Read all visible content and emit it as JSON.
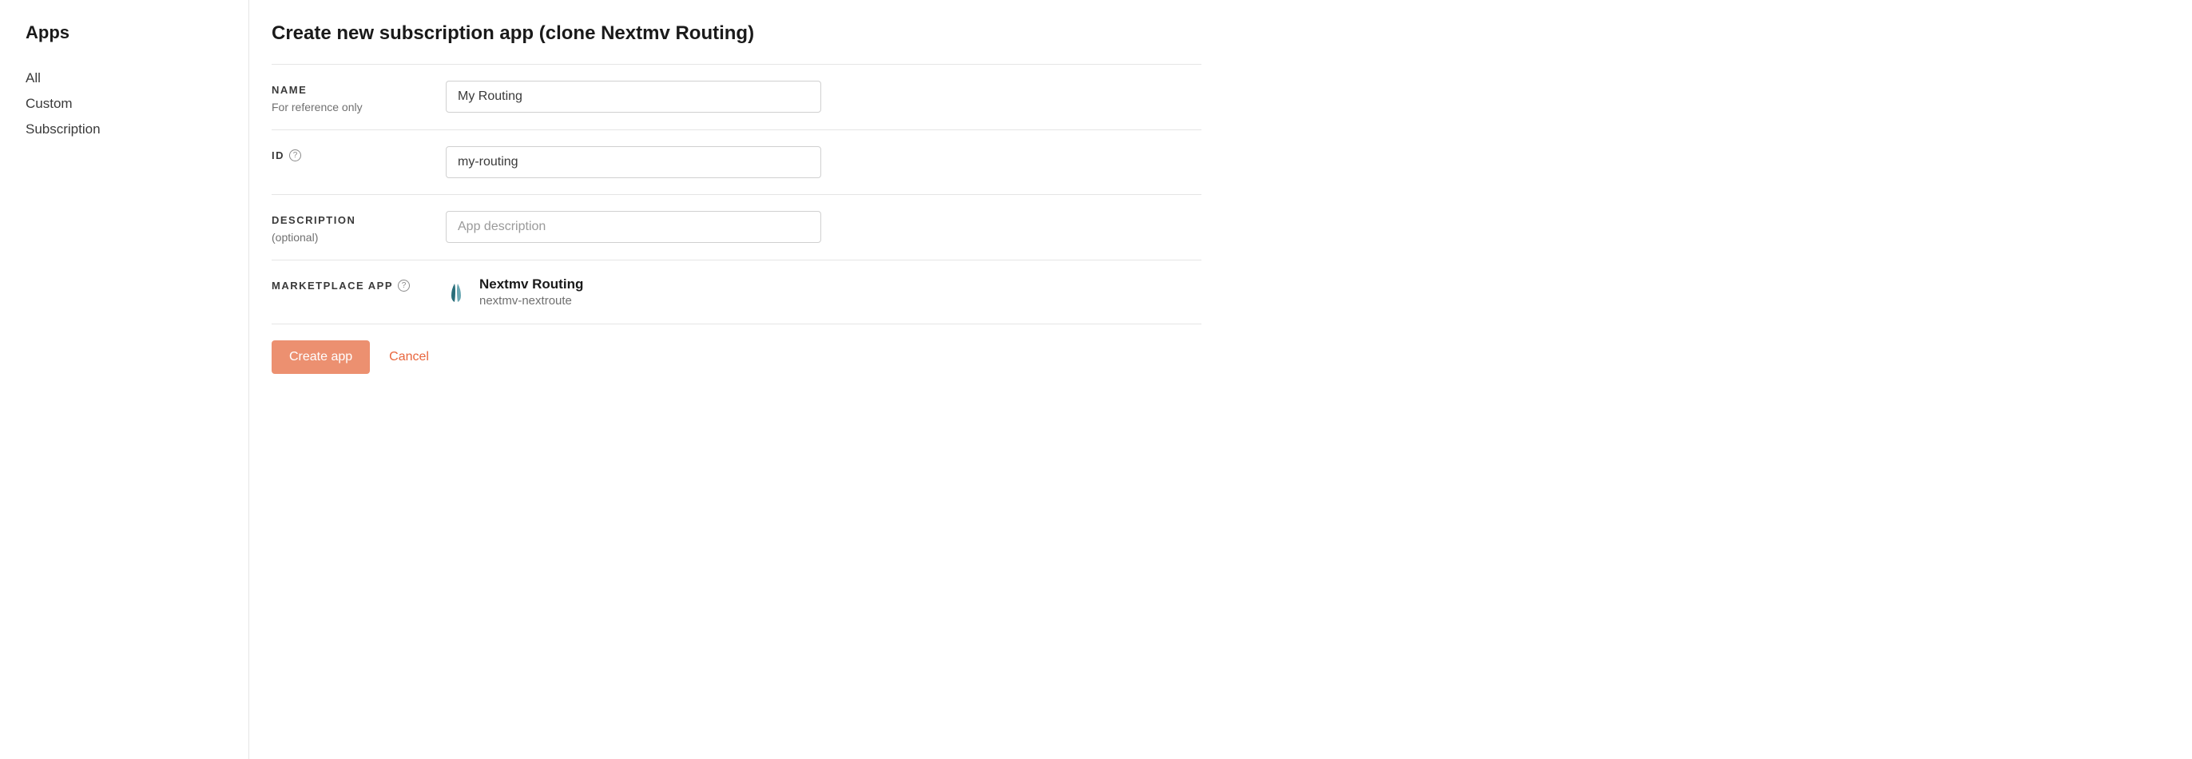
{
  "sidebar": {
    "title": "Apps",
    "items": [
      {
        "label": "All"
      },
      {
        "label": "Custom"
      },
      {
        "label": "Subscription"
      }
    ]
  },
  "page": {
    "title": "Create new subscription app (clone Nextmv Routing)"
  },
  "form": {
    "name": {
      "label": "NAME",
      "sub": "For reference only",
      "value": "My Routing"
    },
    "id": {
      "label": "ID",
      "value": "my-routing"
    },
    "description": {
      "label": "DESCRIPTION",
      "sub": "(optional)",
      "placeholder": "App description",
      "value": ""
    },
    "marketplace": {
      "label": "MARKETPLACE APP",
      "app_name": "Nextmv Routing",
      "app_id": "nextmv-nextroute"
    }
  },
  "actions": {
    "create": "Create app",
    "cancel": "Cancel"
  }
}
